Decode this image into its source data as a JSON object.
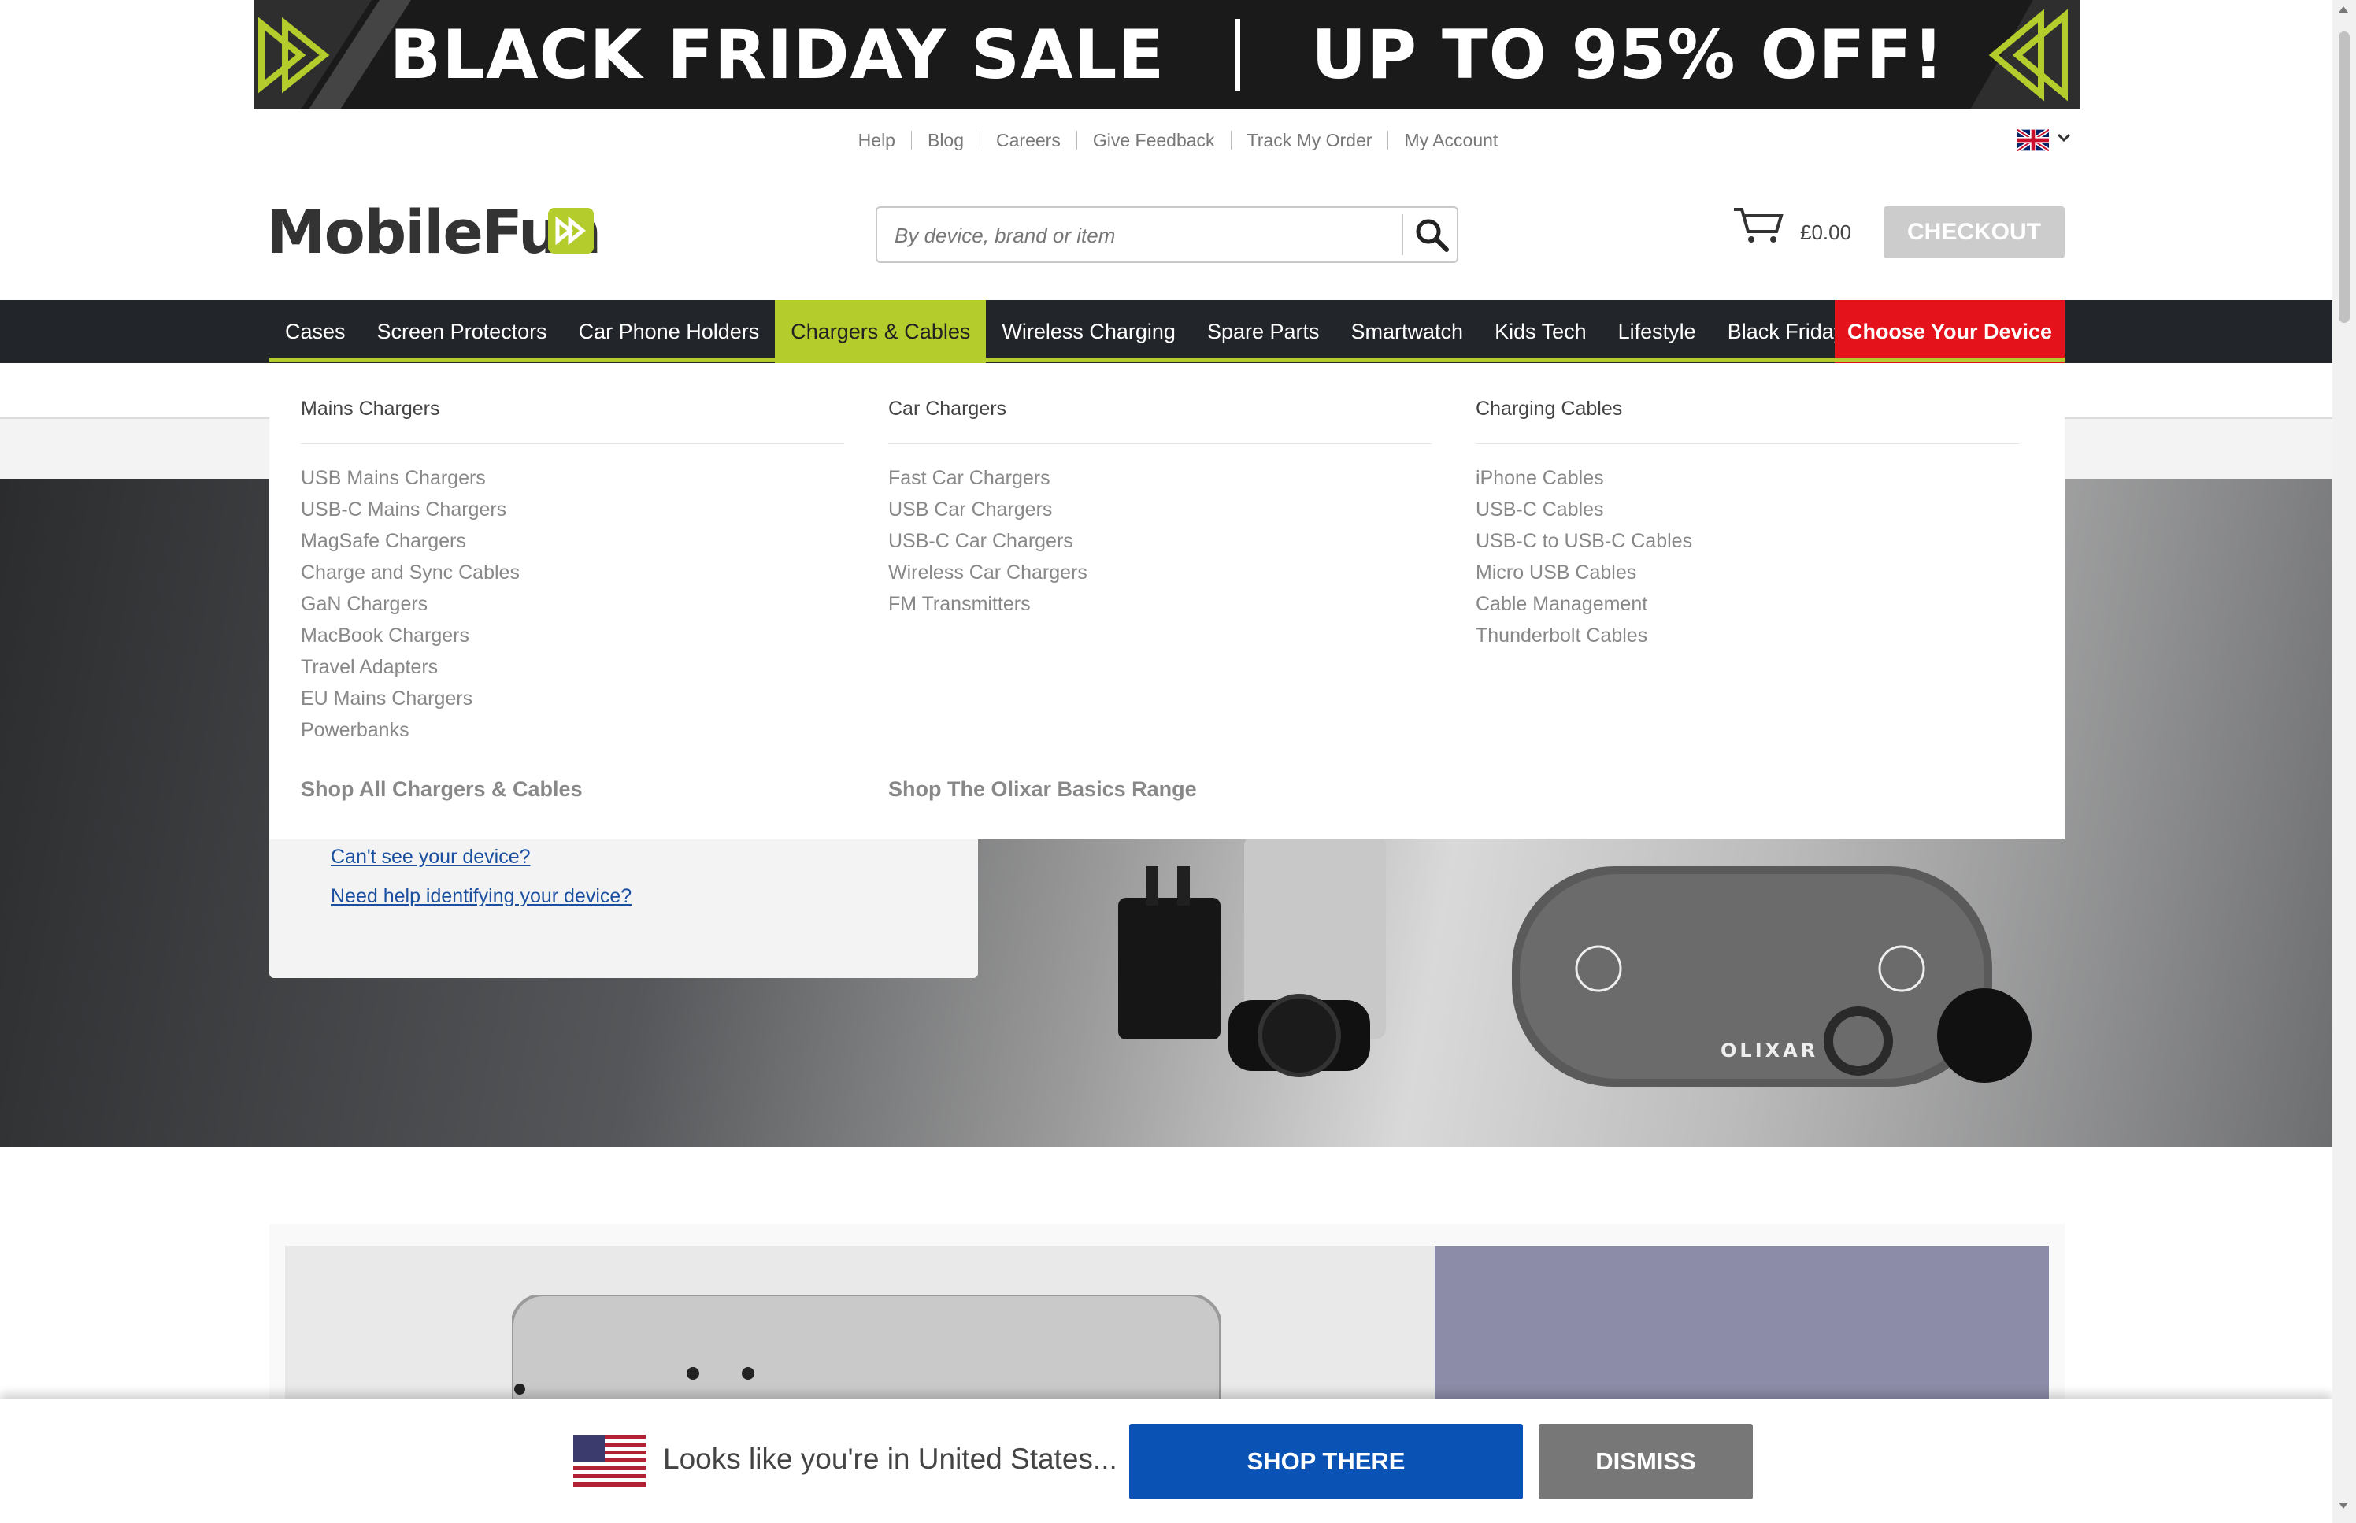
{
  "banner": {
    "left": "BLACK FRIDAY SALE",
    "right": "UP TO 95% OFF!"
  },
  "top_links": [
    "Help",
    "Blog",
    "Careers",
    "Give Feedback",
    "Track My Order",
    "My Account"
  ],
  "logo": {
    "text": "MobileFun"
  },
  "search": {
    "placeholder": "By device, brand or item"
  },
  "cart": {
    "total": "£0.00",
    "checkout_label": "CHECKOUT"
  },
  "nav": {
    "items": [
      "Cases",
      "Screen Protectors",
      "Car Phone Holders",
      "Chargers & Cables",
      "Wireless Charging",
      "Spare Parts",
      "Smartwatch",
      "Kids Tech",
      "Lifestyle",
      "Black Friday"
    ],
    "active": "Chargers & Cables",
    "choose_device": "Choose Your Device"
  },
  "mega_menu": {
    "columns": [
      {
        "title": "Mains Chargers",
        "items": [
          "USB Mains Chargers",
          "USB-C Mains Chargers",
          "MagSafe Chargers",
          "Charge and Sync Cables",
          "GaN Chargers",
          "MacBook Chargers",
          "Travel Adapters",
          "EU Mains Chargers",
          "Powerbanks"
        ],
        "shop_link": "Shop All Chargers & Cables"
      },
      {
        "title": "Car Chargers",
        "items": [
          "Fast Car Chargers",
          "USB Car Chargers",
          "USB-C Car Chargers",
          "Wireless Car Chargers",
          "FM Transmitters"
        ],
        "shop_link": "Shop The Olixar Basics Range"
      },
      {
        "title": "Charging Cables",
        "items": [
          "iPhone Cables",
          "USB-C Cables",
          "USB-C to USB-C Cables",
          "Micro USB Cables",
          "Cable Management",
          "Thunderbolt Cables"
        ],
        "shop_link": ""
      }
    ]
  },
  "device_panel": {
    "cant_see": "Can't see your device?",
    "need_help": "Need help identifying your device?"
  },
  "hero": {
    "brand_mark": "OLIXAR"
  },
  "geo_bar": {
    "message": "Looks like you're in United States...",
    "shop_label": "SHOP THERE",
    "dismiss_label": "DISMISS"
  },
  "colors": {
    "brand_green": "#b4cc2c",
    "nav_bg": "#222529",
    "choose_red": "#e3121b",
    "shop_blue": "#0a52b3"
  }
}
